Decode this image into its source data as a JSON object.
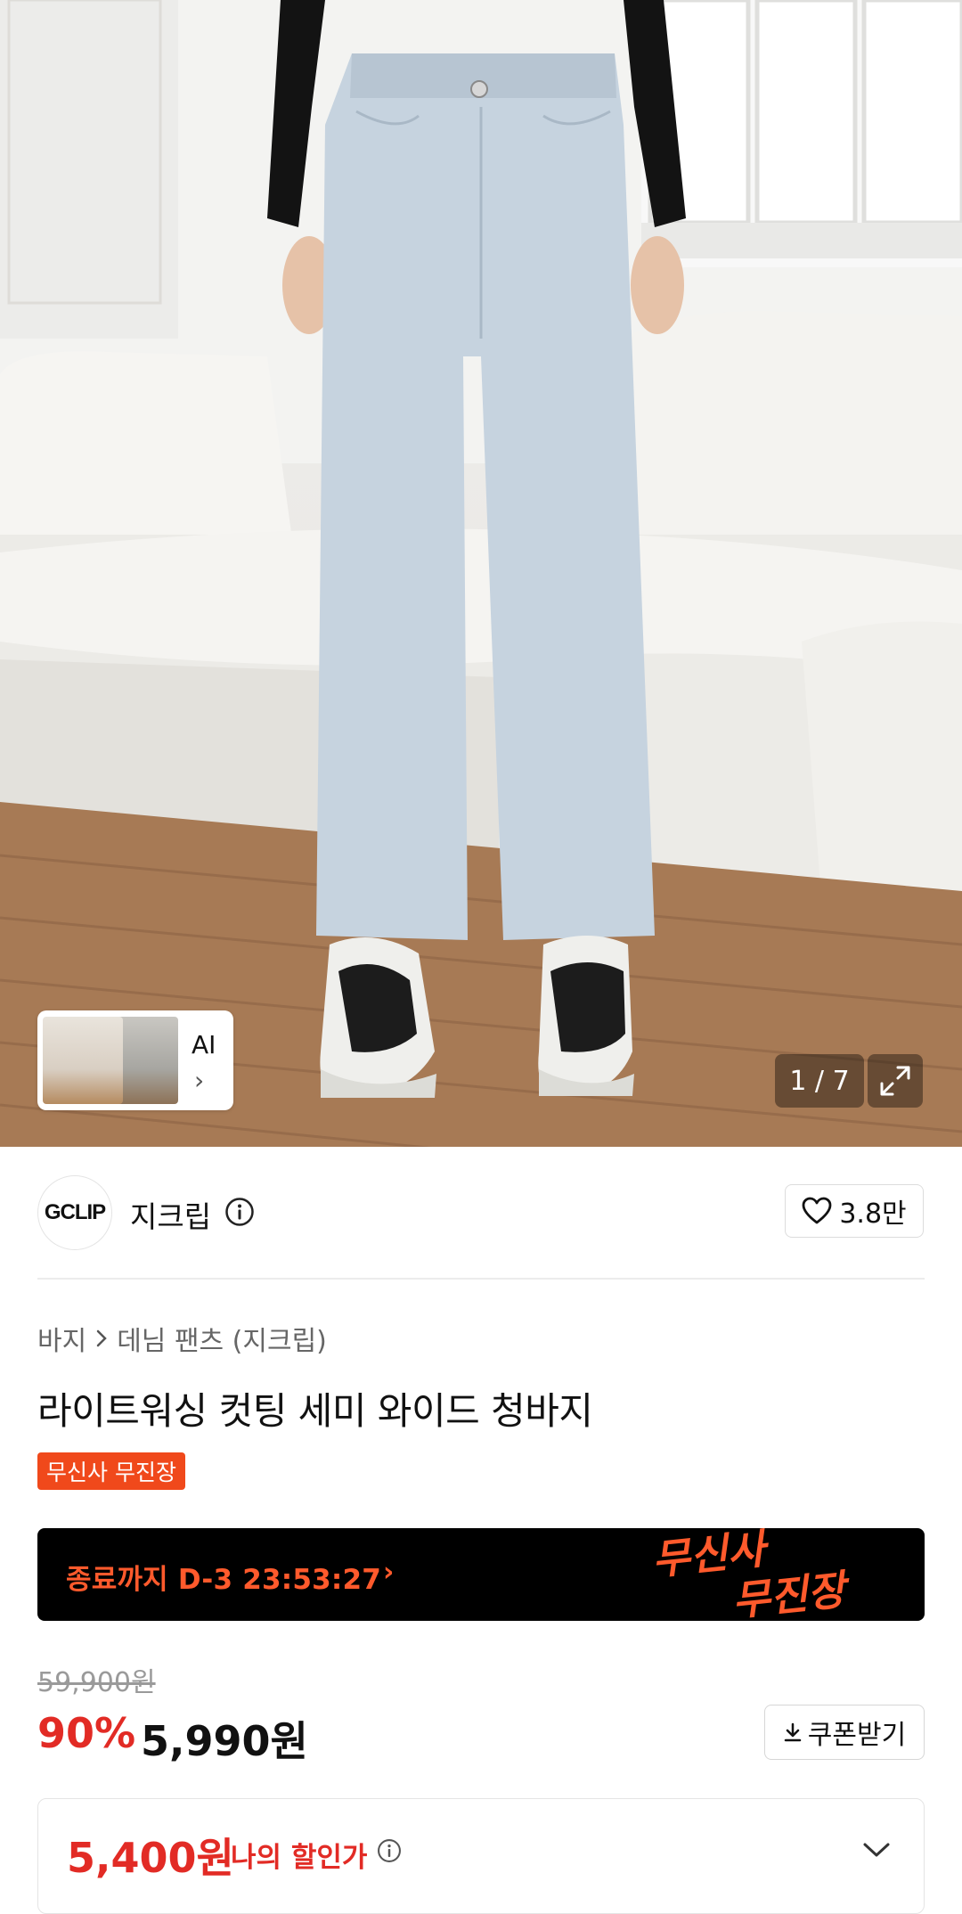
{
  "gallery": {
    "counter": "1 / 7",
    "ai_label": "AI",
    "ai_chevron": "›"
  },
  "brand": {
    "logo_text": "GCLIP",
    "name": "지크립",
    "likes": "3.8만"
  },
  "product": {
    "breadcrumb": [
      "바지",
      "데님 팬츠 (지크립)"
    ],
    "title": "라이트워싱 컷팅 세미 와이드 청바지",
    "badge": "무신사 무진장"
  },
  "timer_banner": {
    "text": "종료까지 D-3 23:53:27",
    "chevron": "›",
    "logo_line1": "무신사",
    "logo_line2": "무진장"
  },
  "price": {
    "original": "59,900원",
    "discount_rate": "90%",
    "sale": "5,990원",
    "coupon_button": "쿠폰받기"
  },
  "my_discount": {
    "price": "5,400원",
    "label": "나의 할인가"
  },
  "colors": {
    "accent_red": "#e22b25",
    "badge_orange": "#f0491b",
    "banner_orange": "#ff5a2c"
  }
}
